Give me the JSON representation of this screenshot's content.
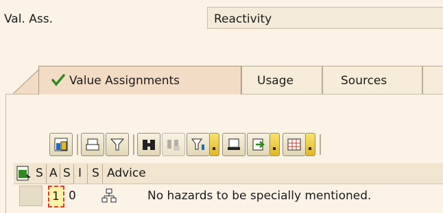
{
  "header": {
    "label": "Val. Ass.",
    "value": "Reactivity"
  },
  "tabs": [
    {
      "label": "Value Assignments",
      "active": true,
      "icon": "checkmark-icon"
    },
    {
      "label": "Usage",
      "active": false
    },
    {
      "label": "Sources",
      "active": false
    }
  ],
  "toolbar": {
    "buttons": [
      "details-icon",
      "print-icon",
      "filter-funnel-icon",
      "find-icon",
      "find-next-icon",
      "set-filter-icon",
      "print-preview-icon",
      "export-icon",
      "change-layout-icon"
    ]
  },
  "table": {
    "columns": [
      "S",
      "A",
      "S",
      "I",
      "S",
      "Advice"
    ],
    "rows": [
      {
        "s1": "1",
        "a": "0",
        "s2": "",
        "i": "hierarchy-icon",
        "s3": "",
        "advice": "No hazards to be specially mentioned."
      }
    ]
  },
  "colors": {
    "background": "#fbf3e6",
    "accent_check": "#2e8b1e",
    "selection_border": "#e03a2c"
  }
}
